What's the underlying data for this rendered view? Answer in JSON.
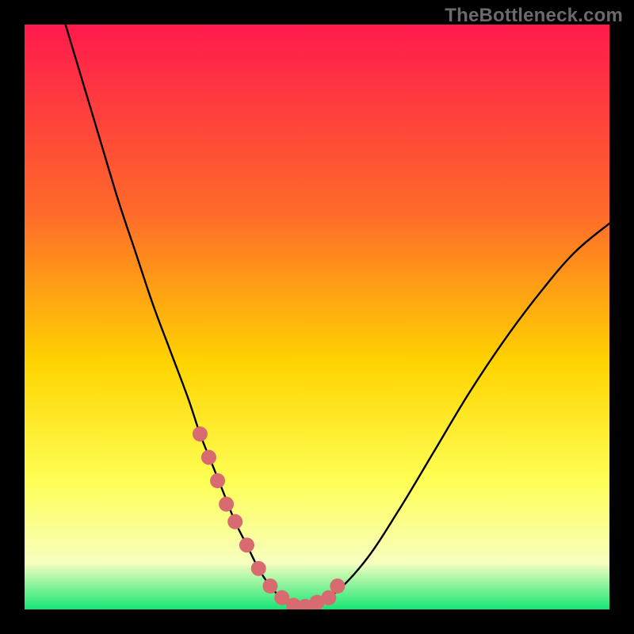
{
  "watermark": "TheBottleneck.com",
  "colors": {
    "frame": "#000000",
    "grad_top": "#ff1a4d",
    "grad_mid1": "#ff6a2a",
    "grad_mid2": "#ffd400",
    "grad_mid3": "#ffff55",
    "grad_mid4": "#f7ffbf",
    "grad_bottom": "#17e676",
    "curve": "#000000",
    "marker_fill": "#d86b6f",
    "marker_stroke": "#d86b6f"
  },
  "chart_data": {
    "type": "line",
    "title": "",
    "xlabel": "",
    "ylabel": "",
    "xlim": [
      0,
      100
    ],
    "ylim": [
      0,
      100
    ],
    "legend": null,
    "annotations": [
      "TheBottleneck.com"
    ],
    "series": [
      {
        "name": "bottleneck-curve",
        "x": [
          7,
          10,
          13,
          16,
          19,
          22,
          25,
          28,
          30,
          32,
          34,
          36,
          38,
          40,
          42,
          44,
          47,
          52,
          58,
          64,
          70,
          76,
          82,
          88,
          94,
          100
        ],
        "y": [
          100,
          90,
          80,
          70,
          61,
          52,
          44,
          36,
          30,
          25,
          20,
          15,
          11,
          7,
          4,
          2,
          0.5,
          2,
          8,
          17,
          27,
          37,
          46,
          54,
          61,
          66
        ]
      }
    ],
    "markers": {
      "name": "highlight-dots",
      "x": [
        30,
        31.5,
        33,
        34.5,
        36,
        38,
        40,
        42,
        44,
        46,
        48,
        50,
        52,
        53.5
      ],
      "y": [
        30,
        26,
        22,
        18,
        15,
        11,
        7,
        4,
        2,
        0.7,
        0.5,
        1.2,
        2,
        4
      ]
    }
  }
}
